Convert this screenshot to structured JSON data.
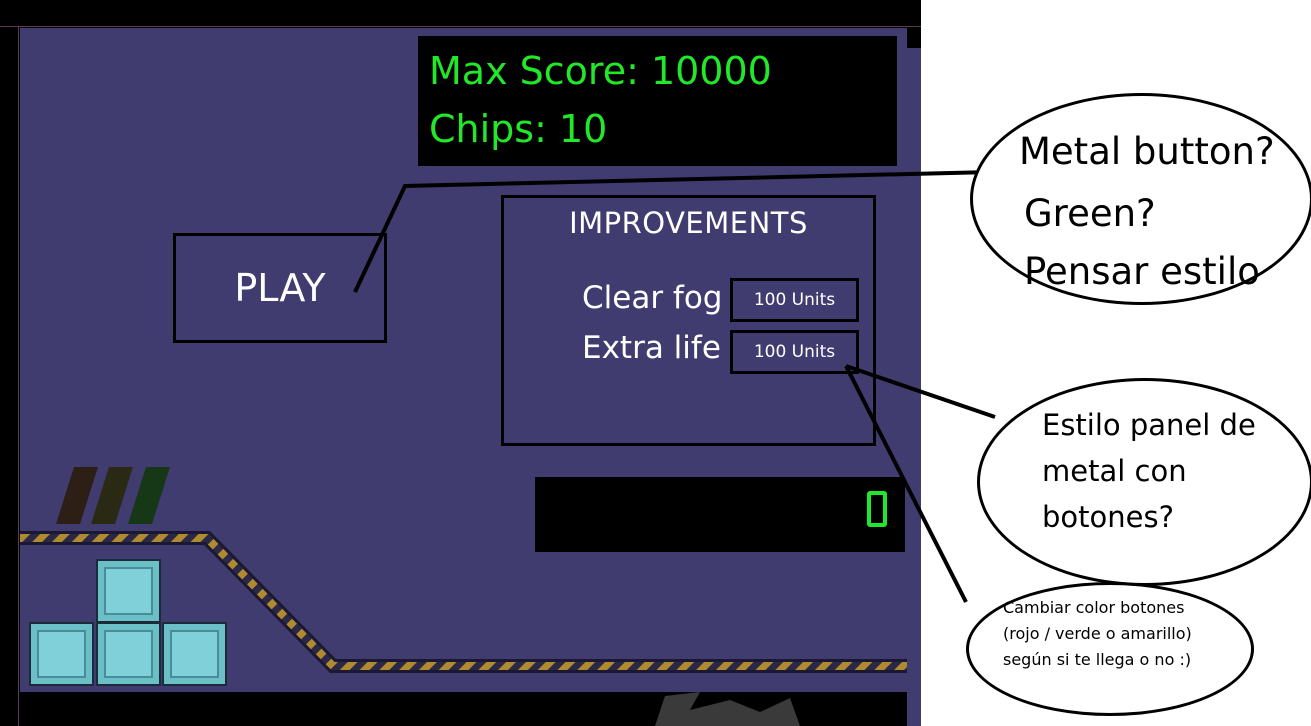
{
  "hud": {
    "max_score": "Max Score: 10000",
    "chips": "Chips: 10"
  },
  "menu": {
    "play_label": "PLAY"
  },
  "improvements": {
    "title": "IMPROVEMENTS",
    "items": [
      {
        "label": "Clear fog",
        "cost": "100 Units"
      },
      {
        "label": "Extra life",
        "cost": "100 Units"
      }
    ]
  },
  "notes": {
    "note1": [
      "Metal button?",
      "Green?",
      "Pensar estilo"
    ],
    "note2": [
      "Estilo panel de",
      "metal con",
      "botones?"
    ],
    "note3": [
      "Cambiar color botones",
      "(rojo / verde o amarillo)",
      "según si te llega o no :)"
    ]
  },
  "colors": {
    "hud_text": "#22e82a",
    "background": "#403c70",
    "crate": "#6bbfc7",
    "hazard_stripe": "#b08a2e"
  }
}
